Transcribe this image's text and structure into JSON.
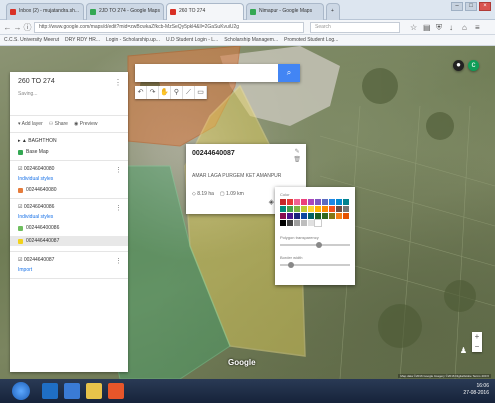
{
  "browser": {
    "tabs": [
      {
        "label": "Inbox (2) - mujatandra.sh...",
        "favicon": "gmail-icon",
        "color": "#d93025",
        "active": false
      },
      {
        "label": "2JD TO 274 - Google Maps",
        "favicon": "maps-icon",
        "color": "#34a853",
        "active": false
      },
      {
        "label": "260 TO 274",
        "favicon": "pdf-icon",
        "color": "#d93025",
        "active": true
      },
      {
        "label": "Nimapur - Google Maps",
        "favicon": "maps-icon",
        "color": "#34a853",
        "active": false
      }
    ],
    "url": "http://www.google.com/maps/d/edit?mid=zwBcwkaZfkcb-MzSeQy5pkl4&ll=2GaSuKvuiU2g",
    "search_placeholder": "Search",
    "bookmarks": [
      "C.C.S. University Meerut",
      "DRY RDY HR...",
      "Login - Scholarship.up...",
      "U.D Student Login - L...",
      "Scholarship Managem...",
      "Promoted Student Log..."
    ]
  },
  "panel": {
    "title": "260 TO 274",
    "subtitle": "Saving...",
    "actions": [
      "Add layer",
      "Share",
      "Preview"
    ],
    "base_layer": {
      "title": "BAGHTHON",
      "item": "Base Map"
    },
    "layers": [
      {
        "title": "00246040080",
        "style": "Individual styles",
        "items": [
          {
            "label": "00244640080",
            "color": "#e67c3b",
            "selected": false
          }
        ]
      },
      {
        "title": "00246040086",
        "style": "Individual styles",
        "items": [
          {
            "label": "002446400086",
            "color": "#6fbf5f",
            "selected": false
          },
          {
            "label": "002446440087",
            "color": "#f2d21b",
            "selected": true
          }
        ]
      },
      {
        "title": "00244640087",
        "style": "Import",
        "items": []
      }
    ]
  },
  "map": {
    "search_button_icon": "search-icon",
    "tools": [
      "hand-icon",
      "marker-icon",
      "line-icon",
      "ruler-icon"
    ],
    "logo": "Google",
    "attribution": "Map data ©2016 Google Imagery ©2016 DigitalGlobe Terms 200 ft",
    "popup": {
      "title": "00244640087",
      "text": "AMAR LAGA PURGEM KET AMANPUR",
      "area": "8.19 ha",
      "perimeter": "1.09 km"
    },
    "picker": {
      "color_label": "Color",
      "opacity_label": "Polygon transparency",
      "border_label": "Border width",
      "colors": [
        "#c62828",
        "#e53935",
        "#f06292",
        "#ec407a",
        "#ab47bc",
        "#7e57c2",
        "#5c6bc0",
        "#1e88e5",
        "#0288d1",
        "#00838f",
        "#00897b",
        "#43a047",
        "#7cb342",
        "#c0ca33",
        "#fdd835",
        "#ffb300",
        "#fb8c00",
        "#f4511e",
        "#6d4c41",
        "#757575",
        "#880e4f",
        "#4a148c",
        "#1a237e",
        "#0d47a1",
        "#006064",
        "#1b5e20",
        "#33691e",
        "#827717",
        "#f57f17",
        "#e65100",
        "#000000",
        "#424242",
        "#9e9e9e",
        "#bdbdbd",
        "#e0e0e0",
        "#ffffff"
      ],
      "opacity_value": 0.55,
      "border_value": 0.15
    }
  },
  "taskbar": {
    "time": "16:06",
    "date": "27-08-2016"
  }
}
